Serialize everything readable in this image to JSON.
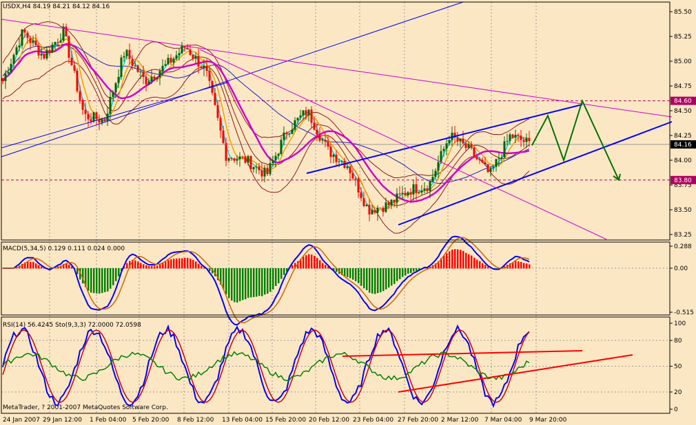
{
  "colors": {
    "background": "#fce7c4",
    "axis": "#000000",
    "grid": "#9a9a9a",
    "bull_candle": "#006400",
    "bear_candle": "#ff0000",
    "bollinger": "#8b1a1a",
    "ma_fast": "#00d8e8",
    "ma_mid": "#f0a000",
    "ma_slow": "#d000d0",
    "trend_blue": "#0000ff",
    "trend_magenta": "#d000d0",
    "forecast": "#007000",
    "level_line": "#b00060",
    "macd_hist_up": "#ff0000",
    "macd_hist_down": "#008000",
    "macd_signal": "#cc6600",
    "rsi": "#008000",
    "stoch_main": "#0000ff",
    "stoch_signal": "#cc0000"
  },
  "main_panel": {
    "header": "USDX,H4  84.19 84.21 84.12 84.16",
    "copyright": "MetaTrader, ? 2001-2007 MetaQuotes Software Corp.",
    "price_ticks": [
      "85.50",
      "85.25",
      "85.00",
      "84.75",
      "84.50",
      "84.25",
      "84.00",
      "83.75",
      "83.50",
      "83.25"
    ],
    "current_price_label": "84.16",
    "upper_level_label": "84.60",
    "lower_level_label": "83.80"
  },
  "macd_panel": {
    "header": "MACD(5,34,5) 0.129 0.111 0.024 0.000",
    "ticks": [
      "0.288",
      "0.00",
      "-0.515"
    ]
  },
  "rsi_panel": {
    "header": "RSI(14) 56.4245   Sto(9,3,3) 72.0000 72.0598",
    "ticks": [
      "100",
      "80",
      "50",
      "20",
      "0"
    ]
  },
  "time_axis": {
    "labels": [
      "24 Jan 2007",
      "29 Jan 12:00",
      "1 Feb 04:00",
      "5 Feb 20:00",
      "8 Feb 12:00",
      "13 Feb 04:00",
      "15 Feb 20:00",
      "20 Feb 12:00",
      "23 Feb 04:00",
      "27 Feb 20:00",
      "2 Mar 12:00",
      "7 Mar 04:00",
      "9 Mar 20:00"
    ]
  },
  "chart_data": [
    {
      "type": "candlestick",
      "symbol": "USDX",
      "timeframe": "H4",
      "last_bar": {
        "open": 84.19,
        "high": 84.21,
        "low": 84.12,
        "close": 84.16
      },
      "ylim": [
        83.2,
        85.6
      ],
      "approx_close_path": [
        [
          "24 Jan 2007",
          84.8
        ],
        [
          "26 Jan",
          85.3
        ],
        [
          "29 Jan 12:00",
          85.05
        ],
        [
          "30 Jan",
          85.3
        ],
        [
          "1 Feb 04:00",
          84.45
        ],
        [
          "2 Feb",
          84.4
        ],
        [
          "5 Feb 20:00",
          85.1
        ],
        [
          "7 Feb",
          84.8
        ],
        [
          "8 Feb 12:00",
          84.95
        ],
        [
          "12 Feb",
          85.15
        ],
        [
          "13 Feb 04:00",
          84.9
        ],
        [
          "14 Feb",
          84.05
        ],
        [
          "15 Feb 20:00",
          84.0
        ],
        [
          "16 Feb",
          83.85
        ],
        [
          "20 Feb 12:00",
          84.3
        ],
        [
          "21 Feb",
          84.5
        ],
        [
          "22 Feb",
          84.1
        ],
        [
          "23 Feb 04:00",
          83.95
        ],
        [
          "26 Feb",
          83.5
        ],
        [
          "27 Feb 20:00",
          83.55
        ],
        [
          "28 Feb",
          83.7
        ],
        [
          "1 Mar",
          83.75
        ],
        [
          "2 Mar 12:00",
          84.25
        ],
        [
          "5 Mar",
          84.1
        ],
        [
          "7 Mar 04:00",
          83.85
        ],
        [
          "8 Mar",
          84.25
        ],
        [
          "9 Mar 20:00",
          84.16
        ]
      ],
      "horizontal_levels": [
        84.6,
        83.8,
        84.16
      ],
      "forecast_path": [
        84.15,
        84.45,
        84.0,
        84.6,
        83.8
      ]
    },
    {
      "type": "bar",
      "name": "MACD(5,34,5)",
      "values_shown": [
        0.129,
        0.111,
        0.024,
        0.0
      ],
      "ylim": [
        -0.515,
        0.288
      ]
    },
    {
      "type": "line",
      "name": "RSI(14) / Sto(9,3,3)",
      "values_shown": {
        "rsi": 56.4245,
        "stoch_main": 72.0,
        "stoch_signal": 72.0598
      },
      "ylim": [
        0,
        100
      ],
      "levels": [
        80,
        50,
        20
      ]
    }
  ]
}
